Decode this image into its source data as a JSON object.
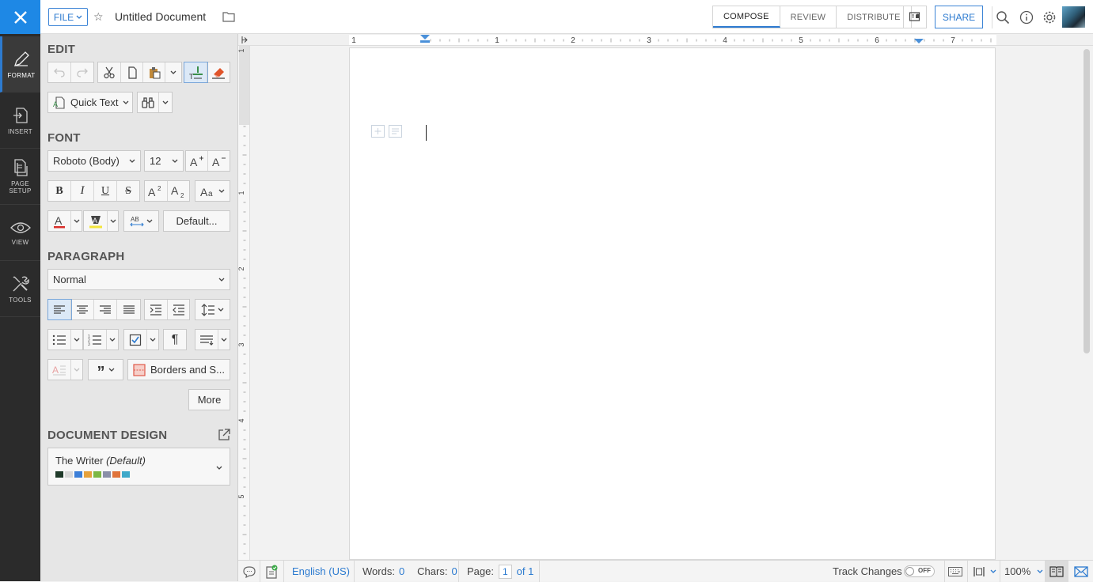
{
  "topbar": {
    "file_label": "FILE",
    "doc_title": "Untitled Document",
    "tabs": [
      "COMPOSE",
      "REVIEW",
      "DISTRIBUTE"
    ],
    "share_label": "SHARE"
  },
  "nav": {
    "items": [
      {
        "label": "FORMAT",
        "icon": "pen-icon"
      },
      {
        "label": "INSERT",
        "icon": "insert-icon"
      },
      {
        "label": "PAGE SETUP",
        "icon": "page-setup-icon"
      },
      {
        "label": "VIEW",
        "icon": "eye-icon"
      },
      {
        "label": "TOOLS",
        "icon": "tools-icon"
      }
    ]
  },
  "panel": {
    "edit_title": "EDIT",
    "quick_text": "Quick Text",
    "font_title": "FONT",
    "font_family": "Roboto (Body)",
    "font_size": "12",
    "default_label": "Default...",
    "paragraph_title": "PARAGRAPH",
    "paragraph_style": "Normal",
    "borders_label": "Borders and S...",
    "more_label": "More",
    "design_title": "DOCUMENT DESIGN",
    "design_name": "The Writer",
    "design_default": "(Default)",
    "design_swatches": [
      "#1f3a2a",
      "#d8d8d8",
      "#3c7fd8",
      "#e6a23c",
      "#7db845",
      "#8a8fa8",
      "#e0743c",
      "#3fa9c9"
    ]
  },
  "ruler": {
    "h_numbers": [
      "1",
      "1",
      "2",
      "3",
      "4",
      "5",
      "6",
      "7"
    ],
    "v_numbers": [
      "1",
      "1",
      "2",
      "3",
      "4",
      "5"
    ]
  },
  "status": {
    "language": "English (US)",
    "words_label": "Words:",
    "words": "0",
    "chars_label": "Chars:",
    "chars": "0",
    "page_label": "Page:",
    "page": "1",
    "page_of": "of 1",
    "track_changes": "Track Changes",
    "track_state": "OFF",
    "zoom": "100%"
  },
  "colors": {
    "accent": "#2d7bd0",
    "close_bg": "#1e88e5",
    "nav_bg": "#2b2b2b"
  }
}
